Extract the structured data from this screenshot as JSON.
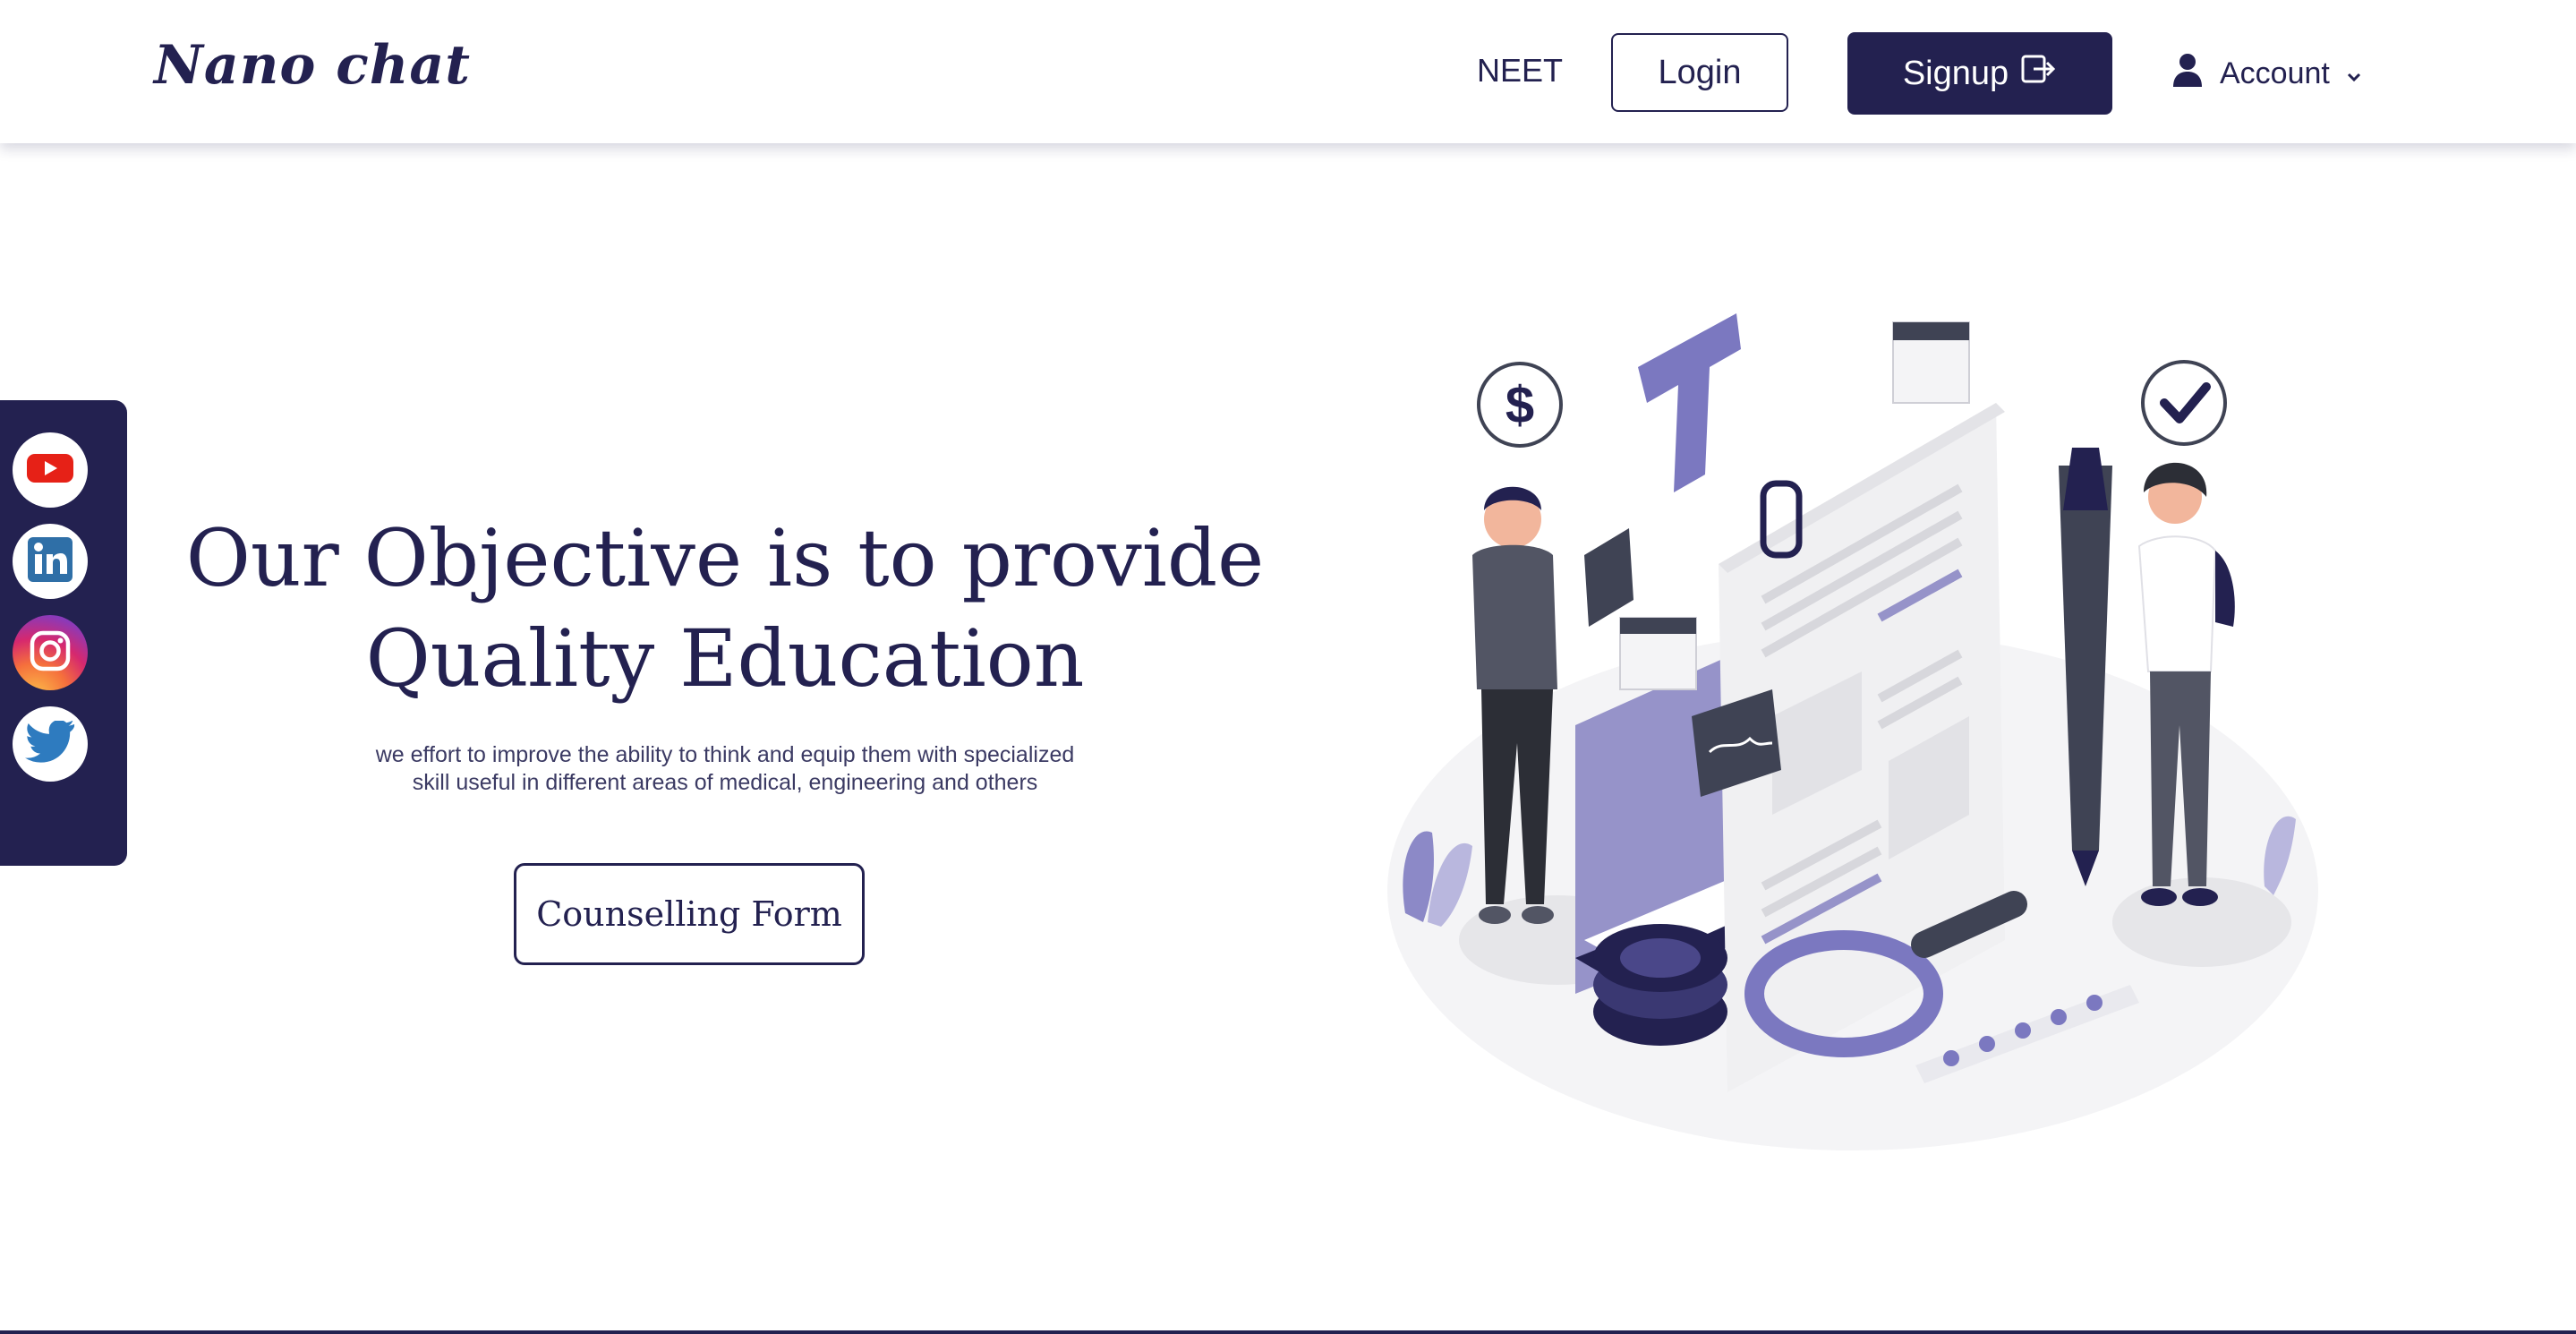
{
  "navbar": {
    "brand": "Nano chat",
    "neet_link": "NEET",
    "login_label": "Login",
    "signup_label": "Signup",
    "account_label": "Account"
  },
  "social": {
    "items": [
      {
        "name": "YouTube",
        "icon": "youtube-icon"
      },
      {
        "name": "LinkedIn",
        "icon": "linkedin-icon"
      },
      {
        "name": "Instagram",
        "icon": "instagram-icon"
      },
      {
        "name": "Twitter",
        "icon": "twitter-icon"
      }
    ]
  },
  "hero": {
    "title_line1": "Our Objective is to provide",
    "title_line2": "Quality Education",
    "subtitle_line1": "we effort to improve the ability to think and equip them with specialized",
    "subtitle_line2": "skill useful in different areas of medical, engineering and others",
    "cta_label": "Counselling Form"
  },
  "colors": {
    "primary": "#232150",
    "accent": "#7b78c0",
    "youtube": "#e62117",
    "linkedin": "#0a66c2",
    "twitter": "#1da1f2"
  }
}
